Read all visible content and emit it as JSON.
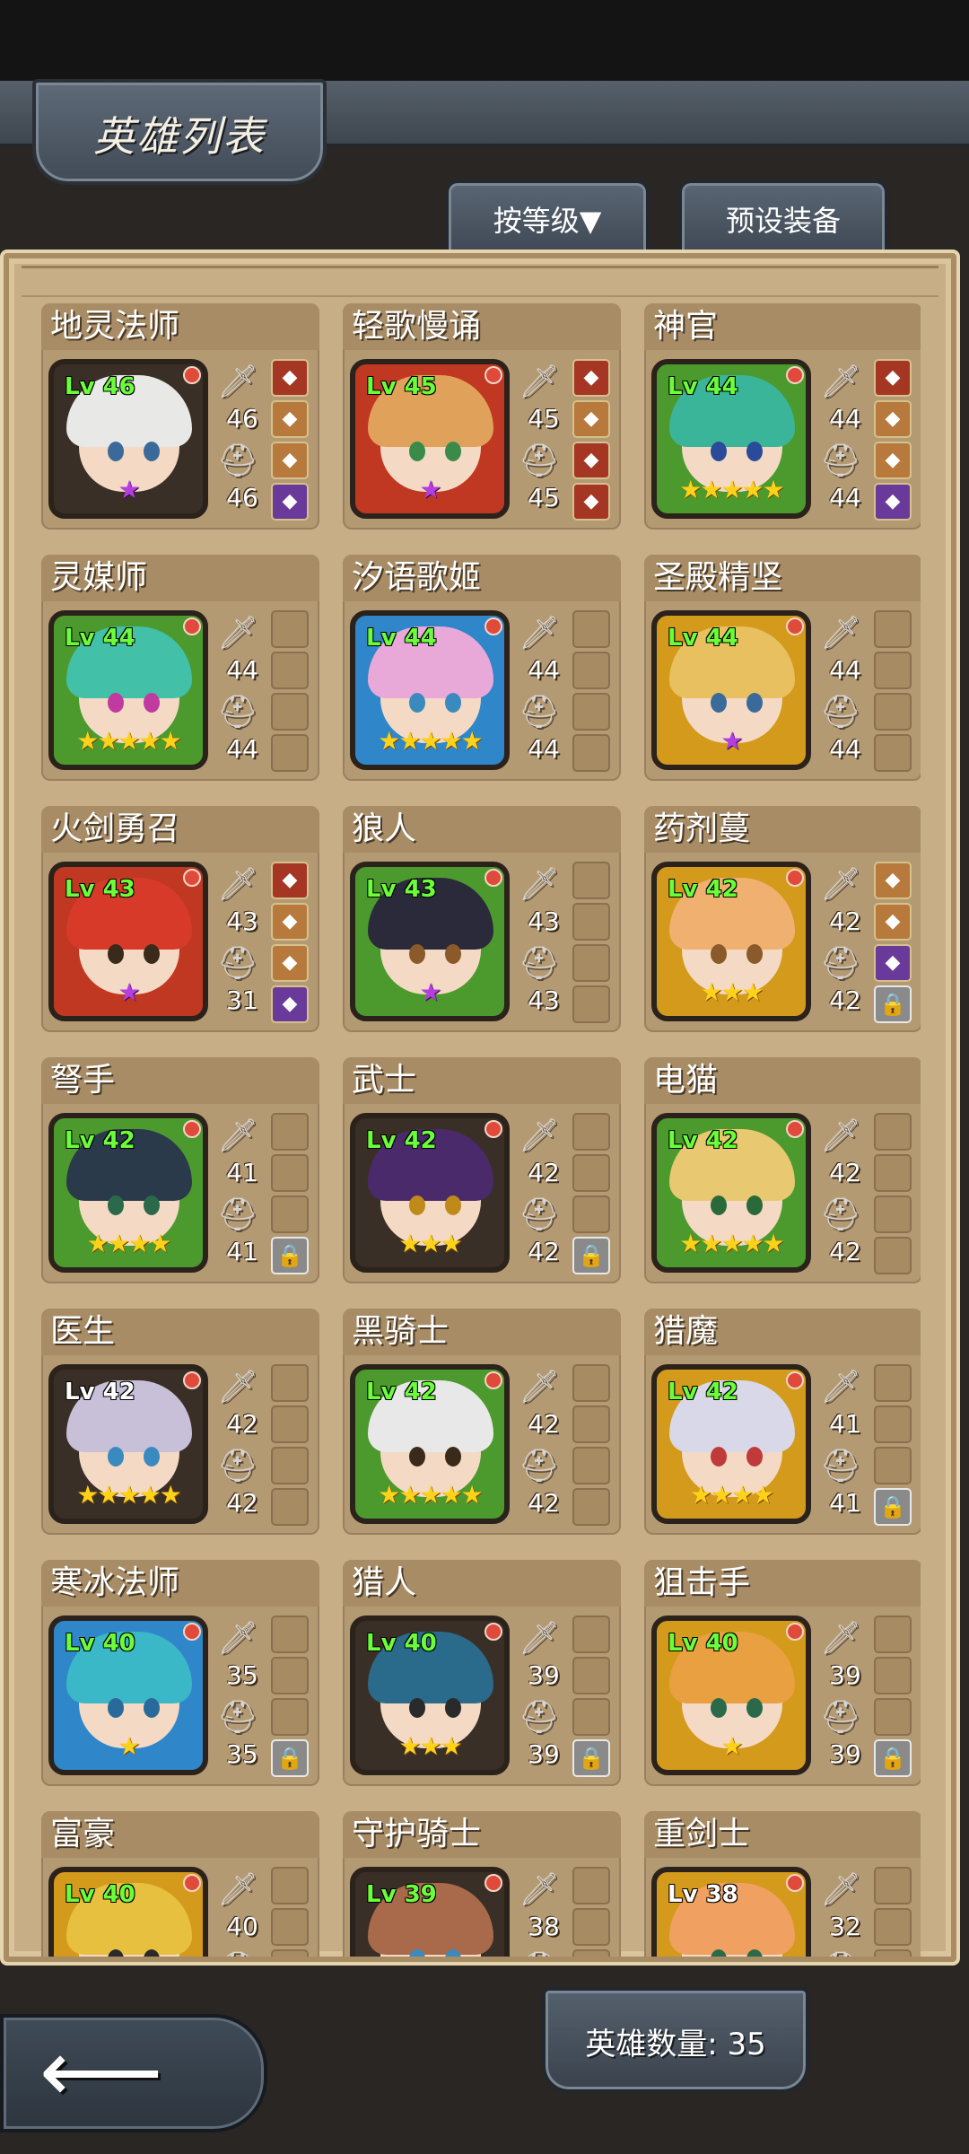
{
  "header": {
    "title": "英雄列表"
  },
  "tabs": {
    "sort_label": "按等级▼",
    "preset_label": "预设装备"
  },
  "footer": {
    "hero_count_label": "英雄数量: 35"
  },
  "heroes": [
    {
      "name": "地灵法师",
      "level": "Lv 46",
      "atk": "46",
      "def": "46",
      "frame": "dark",
      "stars": "★",
      "star_color": "purple",
      "hair": "#e8e8e6",
      "eye": "#3a6a9a",
      "slots": [
        "r",
        "o",
        "o",
        "p"
      ]
    },
    {
      "name": "轻歌慢诵",
      "level": "Lv 45",
      "atk": "45",
      "def": "45",
      "frame": "red",
      "stars": "★",
      "star_color": "purple",
      "hair": "#e0a25a",
      "eye": "#3a8a4a",
      "slots": [
        "r",
        "o",
        "r",
        "r"
      ]
    },
    {
      "name": "神官",
      "level": "Lv 44",
      "atk": "44",
      "def": "44",
      "frame": "green",
      "stars": "★★★★★",
      "star_color": "gold",
      "hair": "#3ab59a",
      "eye": "#2a4a9a",
      "slots": [
        "r",
        "o",
        "o",
        "p"
      ]
    },
    {
      "name": "灵媒师",
      "level": "Lv 44",
      "atk": "44",
      "def": "44",
      "frame": "green",
      "stars": "★★★★★",
      "star_color": "gold",
      "hair": "#42c0a8",
      "eye": "#c03aa0",
      "slots": [
        "",
        "",
        "",
        ""
      ]
    },
    {
      "name": "汐语歌姬",
      "level": "Lv 44",
      "atk": "44",
      "def": "44",
      "frame": "blue",
      "stars": "★★★★★",
      "star_color": "gold",
      "hair": "#e8a8d8",
      "eye": "#3a8ac0",
      "slots": [
        "",
        "",
        "",
        ""
      ]
    },
    {
      "name": "圣殿精坚",
      "level": "Lv 44",
      "atk": "44",
      "def": "44",
      "frame": "gold",
      "stars": "★",
      "star_color": "purple",
      "hair": "#e8c060",
      "eye": "#3a6a9a",
      "slots": [
        "",
        "",
        "",
        ""
      ]
    },
    {
      "name": "火剑勇召",
      "level": "Lv 43",
      "atk": "43",
      "def": "31",
      "frame": "red",
      "stars": "★",
      "star_color": "purple",
      "hair": "#d83a2a",
      "eye": "#3a2a1a",
      "slots": [
        "r",
        "o",
        "o",
        "p"
      ]
    },
    {
      "name": "狼人",
      "level": "Lv 43",
      "atk": "43",
      "def": "43",
      "frame": "green",
      "stars": "★",
      "star_color": "purple",
      "hair": "#2a2a3a",
      "eye": "#8a5a2a",
      "slots": [
        "",
        "",
        "",
        ""
      ]
    },
    {
      "name": "药剂蔓",
      "level": "Lv 42",
      "atk": "42",
      "def": "42",
      "frame": "gold",
      "stars": "★★★",
      "star_color": "gold",
      "hair": "#f0b070",
      "eye": "#8a5a2a",
      "slots": [
        "o",
        "o",
        "p",
        "lock"
      ]
    },
    {
      "name": "弩手",
      "level": "Lv 42",
      "atk": "41",
      "def": "41",
      "frame": "green",
      "stars": "★★★★",
      "star_color": "gold",
      "hair": "#2a3a4a",
      "eye": "#2a6a4a",
      "slots": [
        "",
        "",
        "",
        "lock"
      ]
    },
    {
      "name": "武士",
      "level": "Lv 42",
      "atk": "42",
      "def": "42",
      "frame": "dark",
      "stars": "★★★",
      "star_color": "gold",
      "hair": "#4a2a6a",
      "eye": "#c08a1a",
      "slots": [
        "",
        "",
        "",
        "lock"
      ]
    },
    {
      "name": "电猫",
      "level": "Lv 42",
      "atk": "42",
      "def": "42",
      "frame": "green",
      "stars": "★★★★★",
      "star_color": "gold",
      "hair": "#e8c870",
      "eye": "#2a6a3a",
      "slots": [
        "",
        "",
        "",
        ""
      ]
    },
    {
      "name": "医生",
      "level": "Lv 42",
      "atk": "42",
      "def": "42",
      "frame": "dark",
      "level_color": "white",
      "stars": "★★★★★",
      "star_color": "gold",
      "hair": "#c8c0d8",
      "eye": "#3a8ac0",
      "slots": [
        "",
        "",
        "",
        ""
      ]
    },
    {
      "name": "黑骑士",
      "level": "Lv 42",
      "atk": "42",
      "def": "42",
      "frame": "green",
      "stars": "★★★★★",
      "star_color": "gold",
      "hair": "#e8e8e8",
      "eye": "#3a2a1a",
      "slots": [
        "",
        "",
        "",
        ""
      ]
    },
    {
      "name": "猎魔",
      "level": "Lv 42",
      "atk": "41",
      "def": "41",
      "frame": "gold",
      "stars": "★★★★",
      "star_color": "gold",
      "hair": "#d8d8e8",
      "eye": "#c03a3a",
      "slots": [
        "",
        "",
        "",
        "lock"
      ]
    },
    {
      "name": "寒冰法师",
      "level": "Lv 40",
      "atk": "35",
      "def": "35",
      "frame": "blue",
      "stars": "★",
      "star_color": "gold",
      "hair": "#3ab8c8",
      "eye": "#2a6a9a",
      "slots": [
        "",
        "",
        "",
        "lock"
      ]
    },
    {
      "name": "猎人",
      "level": "Lv 40",
      "atk": "39",
      "def": "39",
      "frame": "dark",
      "stars": "★★★",
      "star_color": "gold",
      "hair": "#2a6a8a",
      "eye": "#2a2a2a",
      "slots": [
        "",
        "",
        "",
        "lock"
      ]
    },
    {
      "name": "狙击手",
      "level": "Lv 40",
      "atk": "39",
      "def": "39",
      "frame": "gold",
      "stars": "★",
      "star_color": "gold",
      "hair": "#e8a040",
      "eye": "#2a6a4a",
      "slots": [
        "",
        "",
        "",
        "lock"
      ]
    },
    {
      "name": "富豪",
      "level": "Lv 40",
      "atk": "40",
      "def": "",
      "frame": "gold",
      "stars": "",
      "star_color": "gold",
      "hair": "#e8c040",
      "eye": "#2a2a2a",
      "slots": [
        "",
        "",
        "",
        ""
      ]
    },
    {
      "name": "守护骑士",
      "level": "Lv 39",
      "atk": "38",
      "def": "",
      "frame": "dark",
      "stars": "",
      "star_color": "gold",
      "hair": "#a86a4a",
      "eye": "#3a8ac0",
      "slots": [
        "",
        "",
        "",
        ""
      ]
    },
    {
      "name": "重剑士",
      "level": "Lv 38",
      "atk": "32",
      "def": "",
      "frame": "gold",
      "level_color": "white",
      "stars": "",
      "star_color": "gold",
      "hair": "#f0a060",
      "eye": "#2a6a4a",
      "slots": [
        "",
        "",
        "",
        ""
      ]
    }
  ]
}
